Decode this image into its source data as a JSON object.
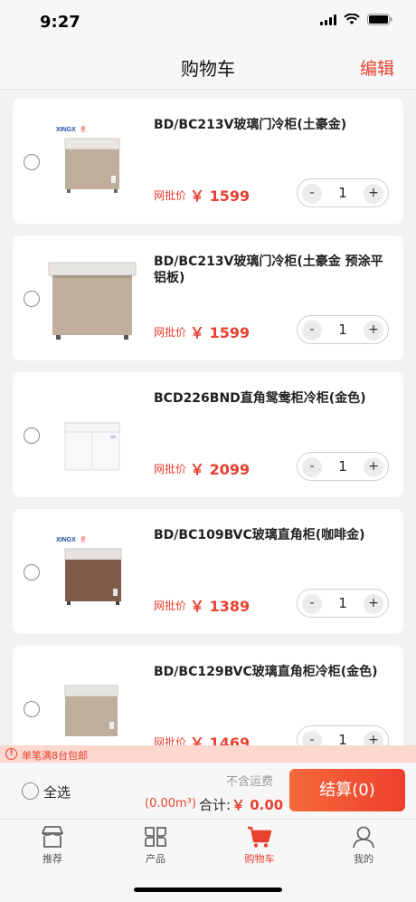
{
  "status_bar": {
    "time": "9:27"
  },
  "nav": {
    "title": "购物车",
    "edit_label": "编辑"
  },
  "price_label": "网批价",
  "items": [
    {
      "name": "BD/BC213V玻璃门冷柜(土豪金)",
      "price": "￥ 1599",
      "qty": "1",
      "image": "chest-freezer-gold",
      "brand": "XINGX"
    },
    {
      "name": "BD/BC213V玻璃门冷柜(土豪金 预涂平铝板)",
      "price": "￥ 1599",
      "qty": "1",
      "image": "chest-freezer-gold-large",
      "brand": ""
    },
    {
      "name": "BCD226BND直角鸳鸯柜冷柜(金色)",
      "price": "￥ 2099",
      "qty": "1",
      "image": "chest-freezer-white",
      "brand": ""
    },
    {
      "name": "BD/BC109BVC玻璃直角柜(咖啡金)",
      "price": "￥ 1389",
      "qty": "1",
      "image": "chest-freezer-coffee",
      "brand": "XINGX"
    },
    {
      "name": "BD/BC129BVC玻璃直角柜冷柜(金色)",
      "price": "￥ 1469",
      "qty": "1",
      "image": "chest-freezer-gold-small",
      "brand": ""
    }
  ],
  "stepper": {
    "minus": "-",
    "plus": "+"
  },
  "notice": {
    "icon": "!",
    "text": "单笔满8台包邮"
  },
  "checkout": {
    "select_all": "全选",
    "shipping_note": "不含运费",
    "volume": "(0.00m³)",
    "total_label": "合计:",
    "total_value": "￥ 0.00",
    "button_label": "结算(0)"
  },
  "tabs": [
    {
      "label": "推荐",
      "icon": "shop-icon",
      "active": false
    },
    {
      "label": "产品",
      "icon": "grid-icon",
      "active": false
    },
    {
      "label": "购物车",
      "icon": "cart-icon",
      "active": true
    },
    {
      "label": "我的",
      "icon": "user-icon",
      "active": false
    }
  ],
  "colors": {
    "accent": "#e8412f",
    "background": "#f2f2f4"
  }
}
